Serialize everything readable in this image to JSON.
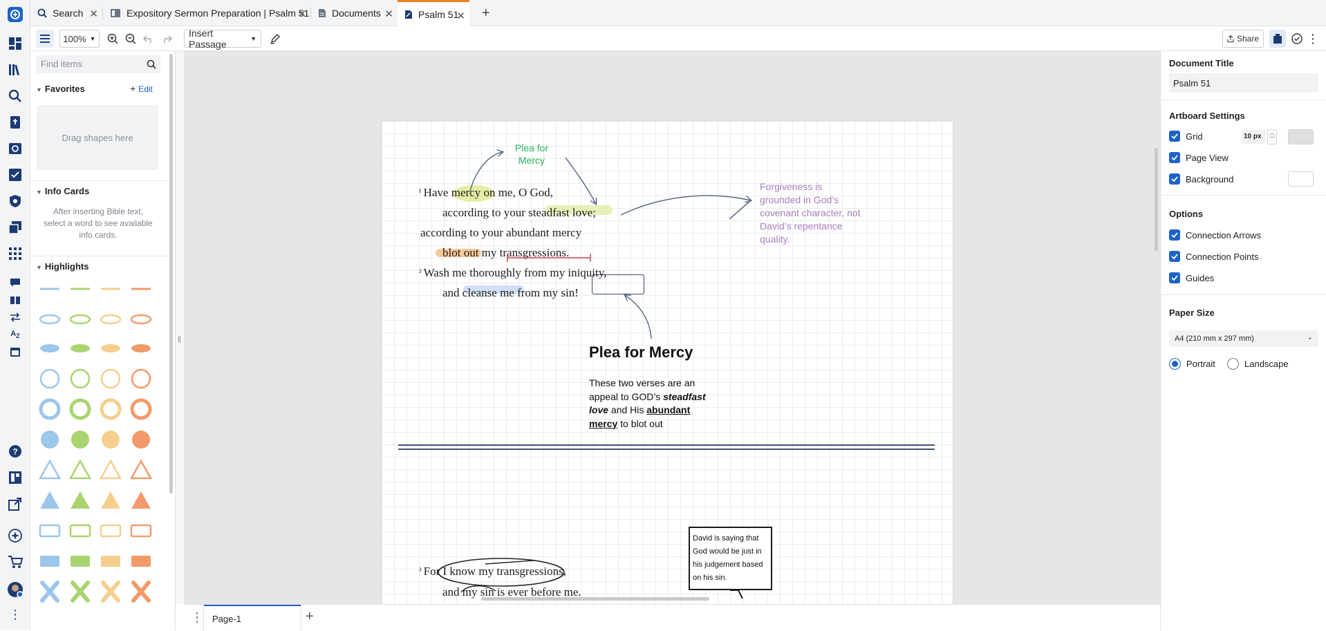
{
  "tabs": [
    {
      "label": "Search",
      "icon": "search-icon",
      "active": false
    },
    {
      "label": "Expository Sermon Preparation | Psalm 51",
      "icon": "guide-icon",
      "active": false
    },
    {
      "label": "Documents",
      "icon": "document-icon",
      "active": false
    },
    {
      "label": "Psalm 51",
      "icon": "canvas-icon",
      "active": true
    }
  ],
  "toolbar": {
    "zoom": "100%",
    "insert_passage": "Insert Passage",
    "share": "Share"
  },
  "left_panel": {
    "search_placeholder": "Find items",
    "favorites_title": "Favorites",
    "favorites_edit": "Edit",
    "drop_hint": "Drag shapes here",
    "info_cards_title": "Info Cards",
    "info_cards_hint": "After inserting Bible text, select a word to see available info cards.",
    "highlights_title": "Highlights",
    "highlight_colors": [
      "#9cc6ea",
      "#a9d46f",
      "#f6cf8f",
      "#f39a6a"
    ],
    "highlight_rows": [
      "underline",
      "ellipse-outline",
      "ellipse-fill",
      "circle-outline",
      "circle-rough",
      "circle-fill",
      "triangle-outline",
      "triangle-fill",
      "rect-outline",
      "rect-fill",
      "x-mark"
    ]
  },
  "canvas": {
    "arrow_label": "Plea for\nMercy",
    "verse_lines": [
      {
        "num": "¹",
        "text": "Have mercy on me, O God,"
      },
      {
        "num": "",
        "text": "according to your steadfast love;"
      },
      {
        "num": "",
        "text": "according to your abundant mercy"
      },
      {
        "num": "",
        "text": "blot out my transgressions."
      },
      {
        "num": "²",
        "text": "Wash me thoroughly from my iniquity,"
      },
      {
        "num": "",
        "text": "and cleanse me from my sin!"
      }
    ],
    "note_purple": "Forgiveness is grounded in God’s covenant character, not David’s repentance quality.",
    "heading": "Plea for Mercy",
    "body_plain_1": "These two verses are an appeal to GOD’s ",
    "body_bold_italic": "steadfast love",
    "body_plain_2": " and His ",
    "body_bold_underline": "abundant mercy",
    "body_plain_3": " to blot out",
    "verse3_num": "³",
    "verse3_text": "For I know my transgressions,",
    "verse3_cont": "and my sin is ever before me.",
    "callout": "David is saying that God would be just in his judgement based on his sin."
  },
  "pagebar": {
    "page_label": "Page-1"
  },
  "properties": {
    "doc_title_label": "Document Title",
    "doc_title_value": "Psalm 51",
    "artboard_title": "Artboard Settings",
    "grid_label": "Grid",
    "grid_value": "10 px",
    "page_view_label": "Page View",
    "background_label": "Background",
    "options_title": "Options",
    "connection_arrows": "Connection Arrows",
    "connection_points": "Connection Points",
    "guides": "Guides",
    "paper_size_title": "Paper Size",
    "paper_size_value": "A4 (210 mm x 297 mm)",
    "portrait": "Portrait",
    "landscape": "Landscape",
    "orientation_selected": "Portrait"
  },
  "colors": {
    "accent_blue": "#1c62c9",
    "tab_active_border": "#f07f1e",
    "arrow_label_green": "#27b561",
    "note_purple": "#a77fbf",
    "rail_icon": "#1d3b73"
  }
}
